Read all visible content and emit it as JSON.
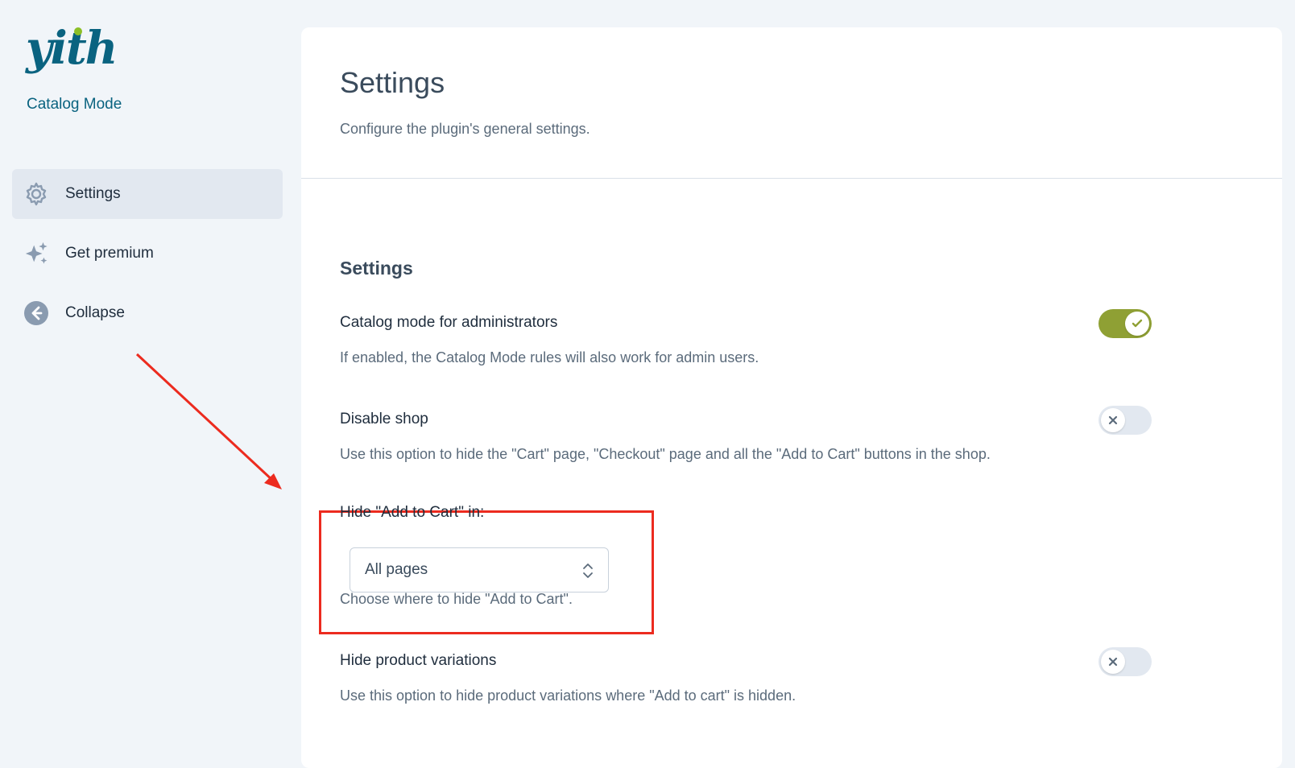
{
  "brand": {
    "logo_text": "yith",
    "subtitle": "Catalog Mode"
  },
  "sidebar": {
    "items": [
      {
        "label": "Settings",
        "icon": "gear-icon",
        "active": true
      },
      {
        "label": "Get premium",
        "icon": "sparkles-icon",
        "active": false
      },
      {
        "label": "Collapse",
        "icon": "arrow-left-circle-icon",
        "active": false
      }
    ]
  },
  "header": {
    "title": "Settings",
    "description": "Configure the plugin's general settings."
  },
  "section": {
    "title": "Settings"
  },
  "options": {
    "admin_mode": {
      "label": "Catalog mode for administrators",
      "description": "If enabled, the Catalog Mode rules will also work for admin users.",
      "enabled": true
    },
    "disable_shop": {
      "label": "Disable shop",
      "description": "Use this option to hide the \"Cart\" page, \"Checkout\" page and all the \"Add to Cart\" buttons in the shop.",
      "enabled": false
    },
    "hide_add_to_cart": {
      "label": "Hide \"Add to Cart\" in:",
      "selected": "All pages",
      "description": "Choose where to hide \"Add to Cart\"."
    },
    "hide_variations": {
      "label": "Hide product variations",
      "description": "Use this option to hide product variations where \"Add to cart\" is hidden.",
      "enabled": false
    }
  },
  "colors": {
    "accent": "#8fa034",
    "brand": "#0a6380",
    "annotation": "#ec2b1f"
  }
}
